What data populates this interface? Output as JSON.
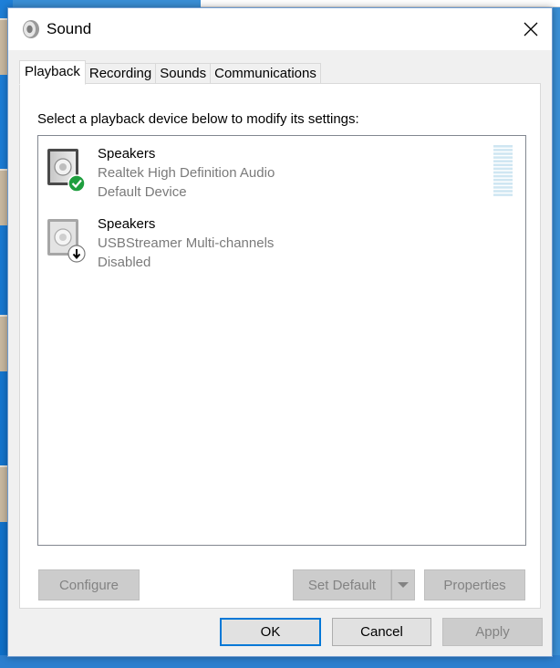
{
  "window": {
    "title": "Sound"
  },
  "tabs": [
    {
      "label": "Playback",
      "active": true
    },
    {
      "label": "Recording",
      "active": false
    },
    {
      "label": "Sounds",
      "active": false
    },
    {
      "label": "Communications",
      "active": false
    }
  ],
  "playback": {
    "instruction": "Select a playback device below to modify its settings:",
    "devices": [
      {
        "name": "Speakers",
        "description": "Realtek High Definition Audio",
        "status": "Default Device",
        "badge": "check-icon",
        "badge_color": "#1e9e3e"
      },
      {
        "name": "Speakers",
        "description": "USBStreamer Multi-channels",
        "status": "Disabled",
        "badge": "down-arrow-icon"
      }
    ],
    "buttons": {
      "configure": "Configure",
      "set_default": "Set Default",
      "properties": "Properties"
    }
  },
  "footer": {
    "ok": "OK",
    "cancel": "Cancel",
    "apply": "Apply"
  },
  "colors": {
    "accent": "#0078d7",
    "meter": "#cfe6f2"
  }
}
